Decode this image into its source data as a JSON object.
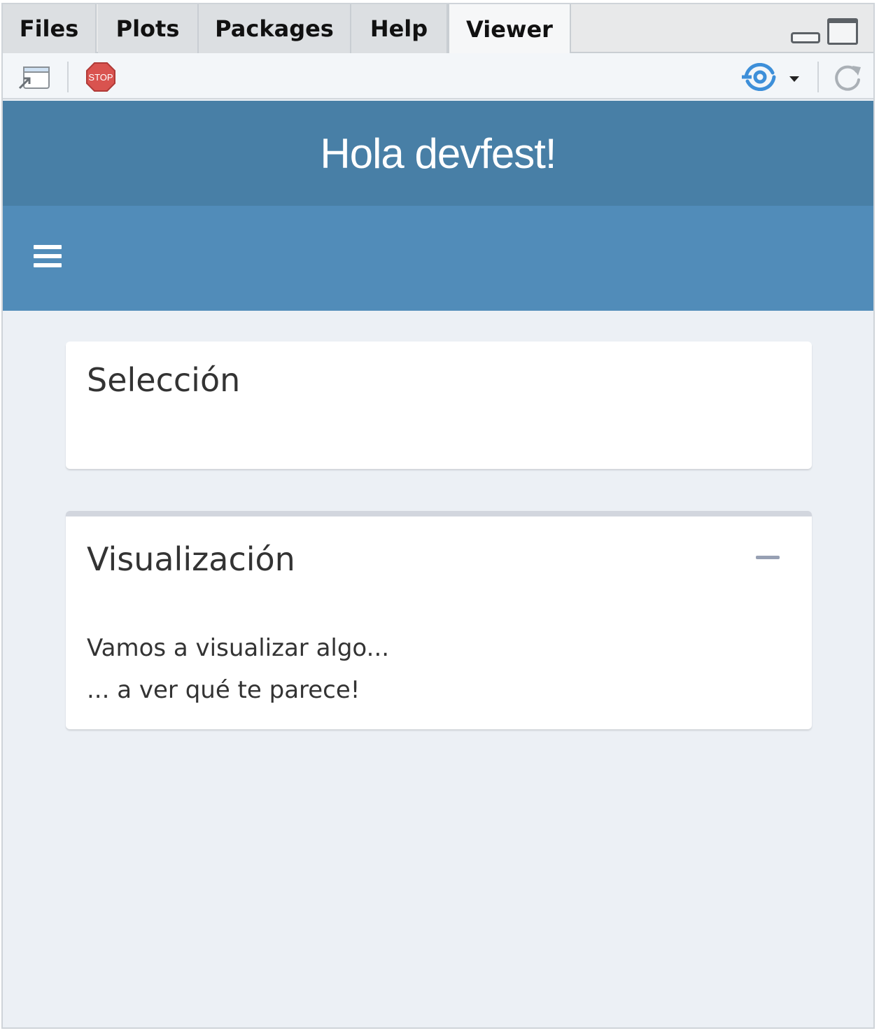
{
  "tabs": [
    {
      "label": "Files"
    },
    {
      "label": "Plots"
    },
    {
      "label": "Packages"
    },
    {
      "label": "Help"
    },
    {
      "label": "Viewer",
      "active": true
    }
  ],
  "toolbar": {
    "export_icon": "export-window-icon",
    "stop_icon": "stop-sign-icon",
    "stop_label": "STOP",
    "publish_icon": "publish-icon",
    "refresh_icon": "refresh-icon"
  },
  "app": {
    "title": "Hola devfest!",
    "sidebar_toggle_icon": "hamburger-menu-icon",
    "colors": {
      "header": "#487fa6",
      "navbar": "#518cb9",
      "content_bg": "#ecf0f5",
      "box_top_border": "#d2d6de"
    }
  },
  "boxes": [
    {
      "title": "Selección"
    },
    {
      "title": "Visualización",
      "collapse_icon": "minus-icon",
      "lines": [
        "Vamos a visualizar algo...",
        "... a ver qué te parece!"
      ]
    }
  ]
}
